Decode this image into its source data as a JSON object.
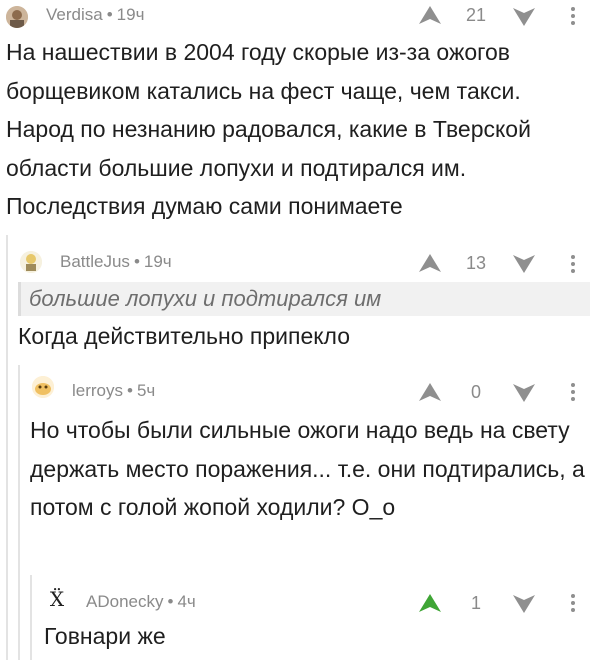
{
  "comments": [
    {
      "author": "Verdisa",
      "time": "19ч",
      "rating": "21",
      "text": "На нашествии в 2004 году скорые из-за ожогов борщевиком катались на фест чаще, чем такси. Народ по незнанию радовался, какие в Тверской области большие лопухи и подтирался им. Последствия думаю сами понимаете",
      "upvoted": false
    },
    {
      "author": "BattleJus",
      "time": "19ч",
      "rating": "13",
      "quote": "большие лопухи и подтирался им",
      "text": "Когда действительно припекло",
      "upvoted": false
    },
    {
      "author": "lerroys",
      "time": "5ч",
      "rating": "0",
      "text": "Но чтобы были сильные ожоги надо ведь на свету держать место поражения... т.е. они подтирались, а потом с голой жопой ходили? О_о",
      "upvoted": false
    },
    {
      "author": "ADonecky",
      "time": "4ч",
      "rating": "1",
      "avatar_glyph": "Ẍ",
      "text": "Говнари же",
      "upvoted": true
    }
  ],
  "colors": {
    "arrow_inactive": "#8f8f8f",
    "arrow_active": "#3fa535",
    "meta": "#8a8a8a",
    "text": "#1f1f1f"
  },
  "icons": [
    "avatar",
    "upvote-arrow-icon",
    "downvote-arrow-icon",
    "more-vertical-icon"
  ]
}
